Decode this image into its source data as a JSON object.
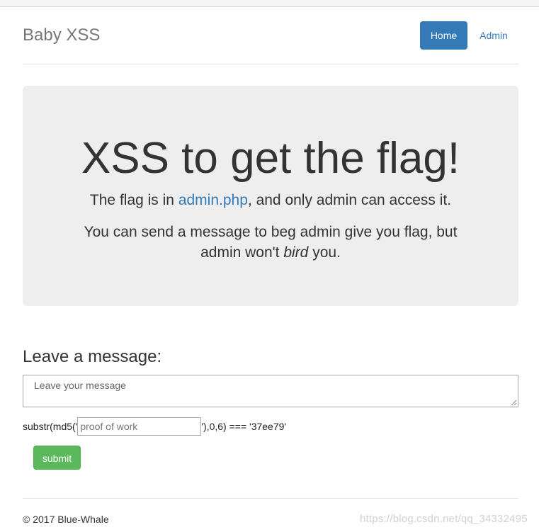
{
  "header": {
    "brand": "Baby XSS",
    "nav": {
      "home": "Home",
      "admin": "Admin"
    }
  },
  "jumbotron": {
    "title": "XSS to get the flag!",
    "lead1_before": "The flag is in ",
    "lead1_link": "admin.php",
    "lead1_after": ", and only admin can access it.",
    "lead2_before": "You can send a message to beg admin give you flag, but admin won't ",
    "lead2_em": "bird",
    "lead2_after": " you."
  },
  "form": {
    "title": "Leave a message:",
    "message_placeholder": "Leave your message",
    "pow_prefix": "substr(md5('",
    "pow_placeholder": "proof of work",
    "pow_suffix": "'),0,6) === '37ee79'",
    "submit_label": "submit"
  },
  "footer": {
    "copyright": "© 2017 Blue-Whale",
    "watermark": "https://blog.csdn.net/qq_34332495"
  },
  "colors": {
    "primary": "#337ab7",
    "success": "#5cb85c",
    "jumbotron_bg": "#eeeeee"
  }
}
